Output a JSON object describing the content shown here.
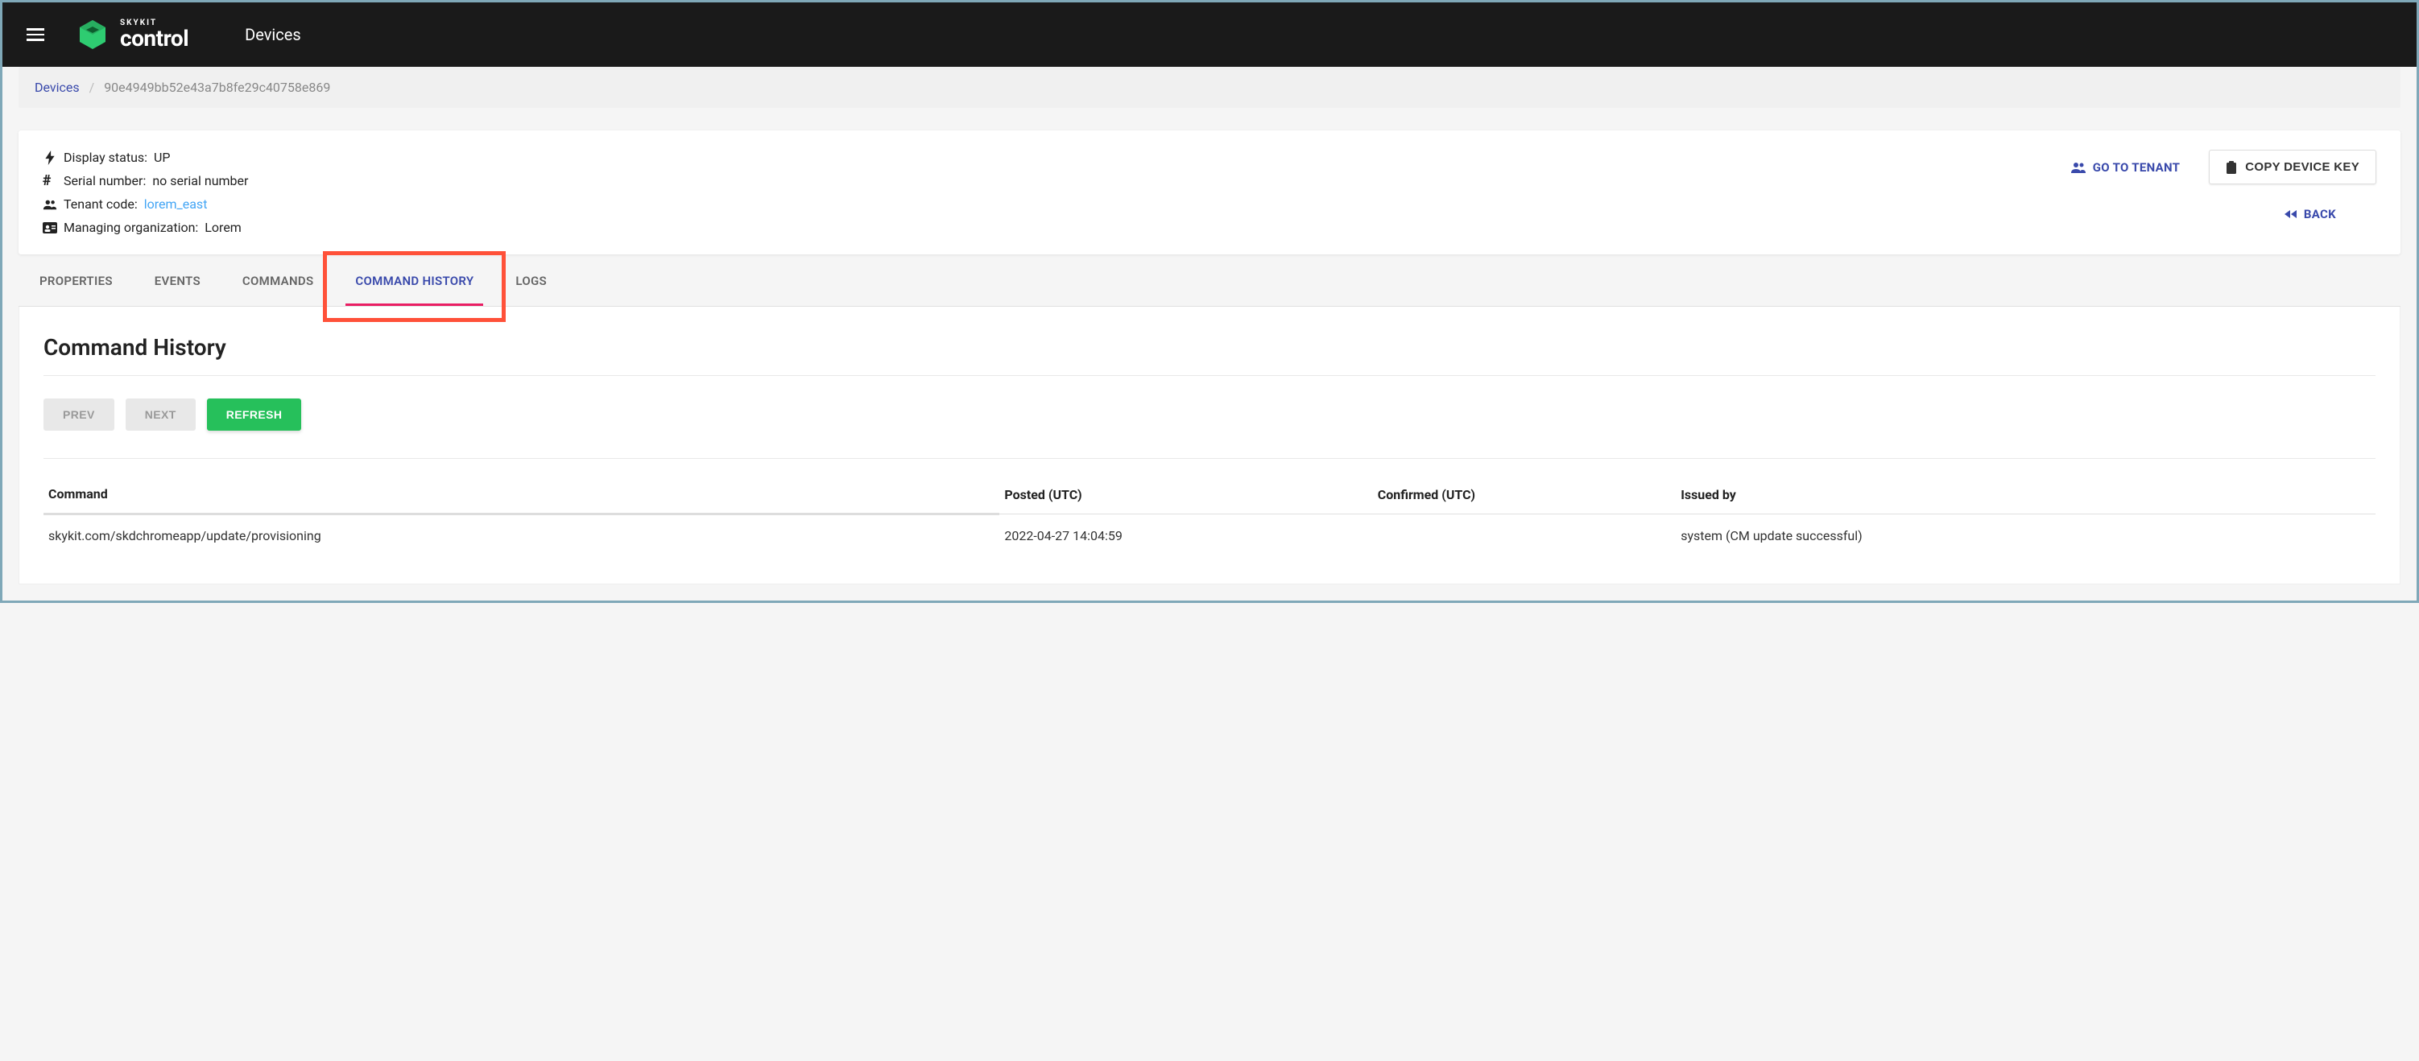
{
  "header": {
    "brand": "SKYKIT",
    "product": "control",
    "section": "Devices"
  },
  "breadcrumb": {
    "root": "Devices",
    "current": "90e4949bb52e43a7b8fe29c40758e869"
  },
  "device_info": {
    "display_status_label": "Display status:",
    "display_status_value": "UP",
    "serial_label": "Serial number:",
    "serial_value": "no serial number",
    "tenant_label": "Tenant code:",
    "tenant_value": "lorem_east",
    "org_label": "Managing organization:",
    "org_value": "Lorem"
  },
  "actions": {
    "go_to_tenant": "GO TO TENANT",
    "copy_device_key": "COPY DEVICE KEY",
    "back": "BACK"
  },
  "tabs": {
    "properties": "PROPERTIES",
    "events": "EVENTS",
    "commands": "COMMANDS",
    "command_history": "COMMAND HISTORY",
    "logs": "LOGS"
  },
  "panel": {
    "title": "Command History",
    "prev": "PREV",
    "next": "NEXT",
    "refresh": "REFRESH"
  },
  "table": {
    "headers": {
      "command": "Command",
      "posted": "Posted (UTC)",
      "confirmed": "Confirmed (UTC)",
      "issued_by": "Issued by"
    },
    "rows": [
      {
        "command": "skykit.com/skdchromeapp/update/provisioning",
        "posted": "2022-04-27 14:04:59",
        "confirmed": "",
        "issued_by": "system (CM update successful)"
      }
    ]
  }
}
